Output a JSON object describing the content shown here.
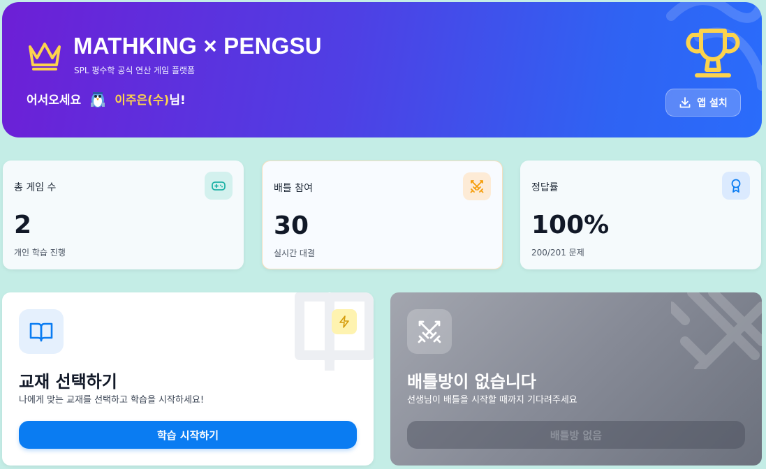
{
  "header": {
    "brand": "MATHKING × PENGSU",
    "subtitle": "SPL 평수학 공식 연산 게임 플랫폼",
    "welcome_prefix": "어서오세요",
    "user_name": "이주은(수)",
    "welcome_suffix": "님!",
    "install_label": "앱 설치"
  },
  "stats": [
    {
      "label": "총 게임 수",
      "value": "2",
      "desc": "개인 학습 진행",
      "icon": "gamepad-icon"
    },
    {
      "label": "배틀 참여",
      "value": "30",
      "desc": "실시간 대결",
      "icon": "crossed-swords-icon"
    },
    {
      "label": "정답률",
      "value": "100%",
      "desc": "200/201 문제",
      "icon": "award-icon"
    }
  ],
  "learn_card": {
    "title": "교재 선택하기",
    "subtitle": "나에게 맞는 교재를 선택하고 학습을 시작하세요!",
    "button": "학습 시작하기",
    "icon": "book-open-icon"
  },
  "battle_card": {
    "title": "배틀방이 없습니다",
    "subtitle": "선생님이 배틀을 시작할 때까지 기다려주세요",
    "button": "배틀방 없음",
    "icon": "crossed-swords-icon"
  },
  "colors": {
    "background": "#c4ede6",
    "header_gradient_start": "#6d1fd6",
    "header_gradient_end": "#2a6cfb",
    "accent_yellow": "#fcd34d",
    "primary_button": "#0a7cf2",
    "stat_teal": "#1fb3a7",
    "stat_orange": "#f59e0b",
    "stat_blue": "#0a7cf2"
  }
}
